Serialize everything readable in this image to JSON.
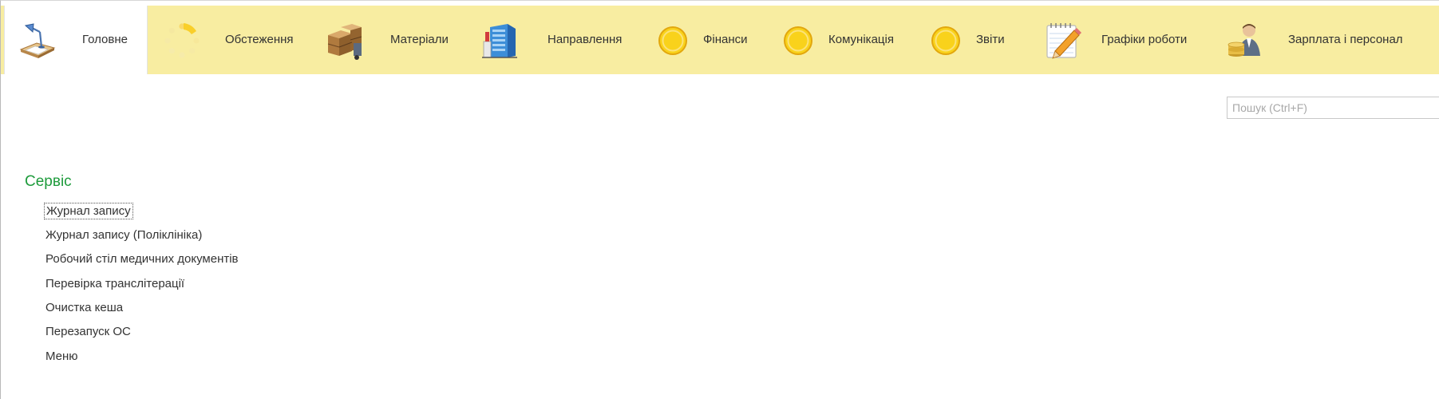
{
  "tabs": [
    {
      "label": "Головне",
      "icon": "desk-lamp-icon",
      "active": true
    },
    {
      "label": "Обстеження",
      "icon": "loading-spinner-icon"
    },
    {
      "label": "Матеріали",
      "icon": "boxes-icon"
    },
    {
      "label": "Направлення",
      "icon": "building-icon"
    },
    {
      "label": "Фінанси",
      "icon": "yellow-circle-icon"
    },
    {
      "label": "Комунікація",
      "icon": "yellow-circle-icon"
    },
    {
      "label": "Звіти",
      "icon": "yellow-circle-icon"
    },
    {
      "label": "Графіки роботи",
      "icon": "notepad-pencil-icon"
    },
    {
      "label": "Зарплата і персонал",
      "icon": "person-coins-icon"
    }
  ],
  "search": {
    "placeholder": "Пошук (Ctrl+F)",
    "value": ""
  },
  "section": {
    "title": "Сервіс",
    "items": [
      {
        "label": "Журнал запису",
        "focused": true
      },
      {
        "label": "Журнал запису (Поліклініка)"
      },
      {
        "label": "Робочий стіл медичних документів"
      },
      {
        "label": "Перевірка транслітерації"
      },
      {
        "label": "Очистка кеша"
      },
      {
        "label": "Перезапуск ОС"
      },
      {
        "label": "Меню"
      }
    ]
  },
  "colors": {
    "topbar": "#f8eda1",
    "section_title": "#1e9b3c",
    "circle_fill": "#f9d21b",
    "circle_ring": "#e2a70d"
  }
}
